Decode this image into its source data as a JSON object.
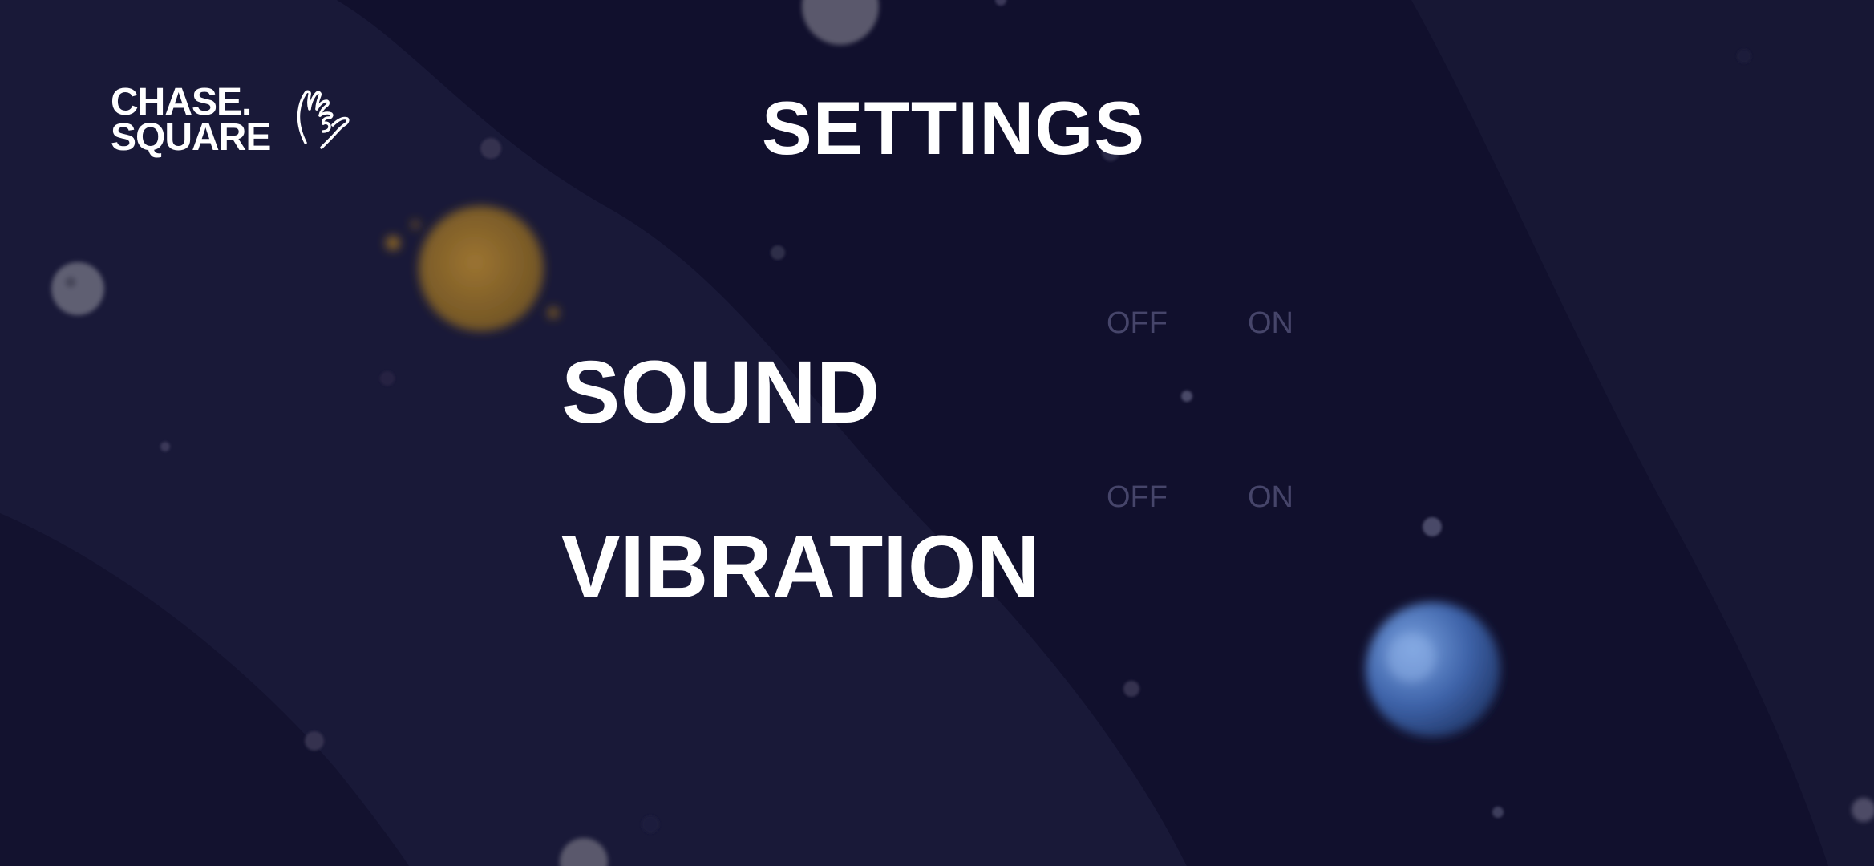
{
  "brand": {
    "line1": "CHASE.",
    "line2": "SQUARE",
    "icon": "hand-gesture-icon"
  },
  "page": {
    "title": "SETTINGS"
  },
  "settings": [
    {
      "label": "SOUND",
      "off_label": "OFF",
      "on_label": "ON"
    },
    {
      "label": "VIBRATION",
      "off_label": "OFF",
      "on_label": "ON"
    }
  ],
  "colors": {
    "background": "#121130",
    "text": "#ffffff",
    "toggle_inactive": "#46456a",
    "planet_orange": "#b8802a",
    "planet_blue": "#3f6fb8"
  }
}
